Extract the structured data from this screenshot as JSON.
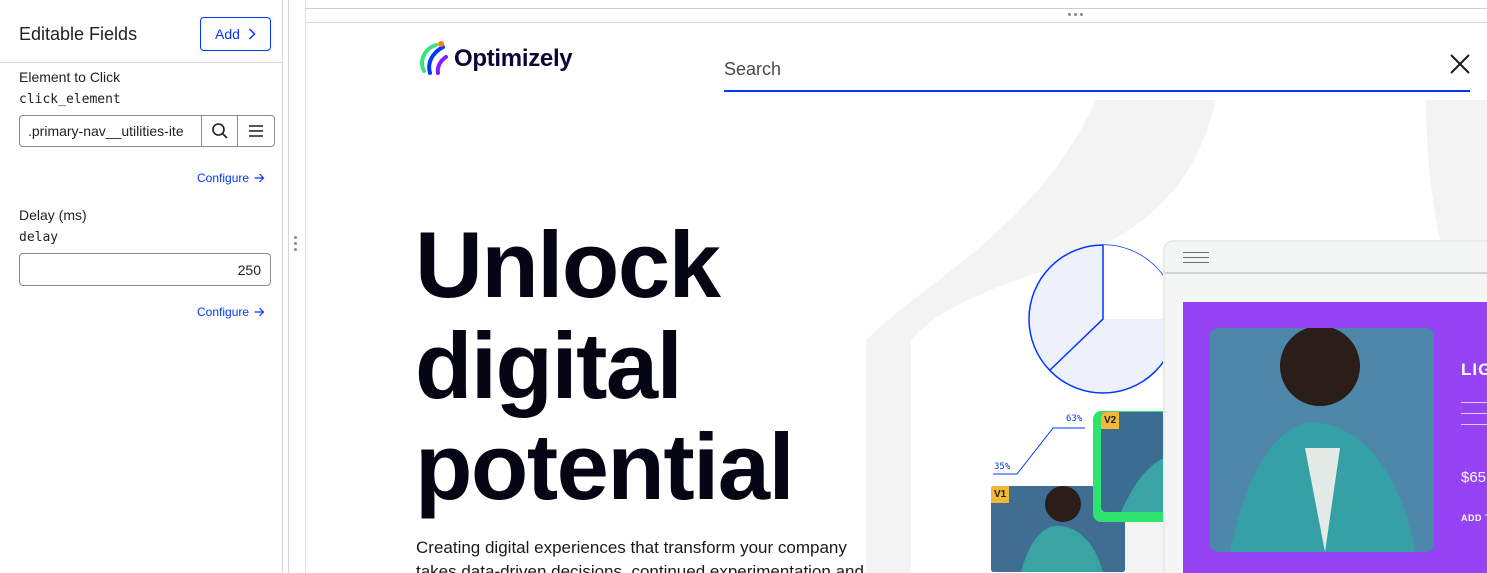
{
  "panel": {
    "title": "Editable Fields",
    "add_label": "Add",
    "fields": [
      {
        "label": "Element to Click",
        "key": "click_element",
        "value": ".primary-nav__utilities-ite",
        "configure": "Configure"
      },
      {
        "label": "Delay (ms)",
        "key": "delay",
        "value": "250",
        "configure": "Configure"
      }
    ]
  },
  "preview": {
    "logo": "Optimizely",
    "search_placeholder": "Search",
    "hero_lines": [
      "Unlock",
      "digital",
      "potential"
    ],
    "hero_copy": "Creating digital experiences that transform your company takes data-driven decisions, continued experimentation and",
    "pie_labels": [
      "63%",
      "35%"
    ],
    "variant_tags": [
      "V1",
      "V2"
    ],
    "promo": {
      "title": "LIG",
      "price": "$65",
      "cta": "ADD T"
    }
  },
  "colors": {
    "accent": "#0037ff",
    "promo_purple": "#9642f5",
    "variant_green": "#2ee36e",
    "tag_yellow": "#f2b936"
  },
  "icons": [
    "chevron-right-icon",
    "search-icon",
    "menu-icon",
    "arrow-right-icon",
    "close-icon",
    "drag-handle-icon",
    "optimizely-logo-icon",
    "hamburger-icon"
  ]
}
